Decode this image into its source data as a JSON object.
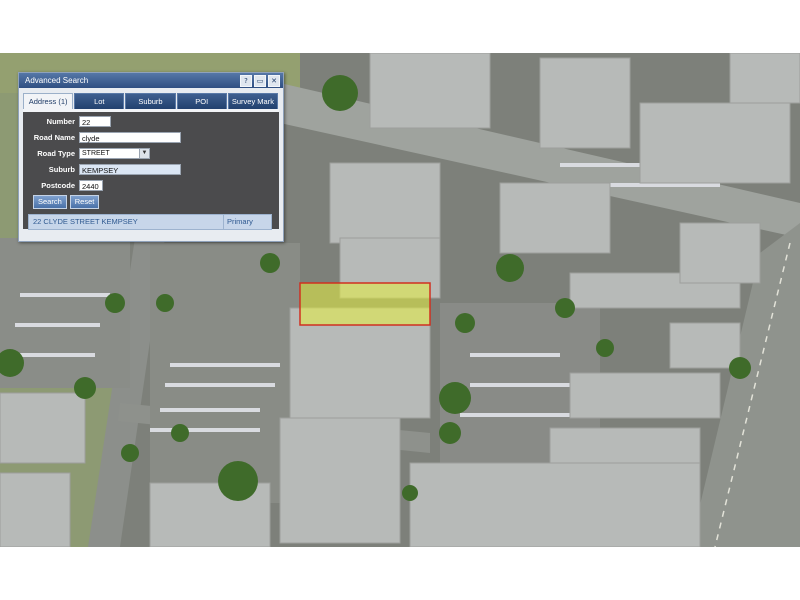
{
  "panel": {
    "title": "Advanced Search",
    "window_buttons": [
      "?",
      "▭",
      "✕"
    ],
    "tabs": [
      {
        "label": "Address (1)",
        "active": true
      },
      {
        "label": "Lot",
        "active": false
      },
      {
        "label": "Suburb",
        "active": false
      },
      {
        "label": "POI",
        "active": false
      },
      {
        "label": "Survey Mark",
        "active": false
      }
    ],
    "fields": {
      "number_label": "Number",
      "number_value": "22",
      "road_name_label": "Road Name",
      "road_name_value": "clyde",
      "road_type_label": "Road Type",
      "road_type_value": "STREET",
      "suburb_label": "Suburb",
      "suburb_value": "KEMPSEY",
      "postcode_label": "Postcode",
      "postcode_value": "2440"
    },
    "buttons": {
      "search": "Search",
      "reset": "Reset"
    },
    "result": {
      "address": "22 CLYDE STREET KEMPSEY",
      "type": "Primary"
    }
  },
  "map": {
    "highlight_color": "#e8f040",
    "highlight_outline": "#d03020"
  }
}
